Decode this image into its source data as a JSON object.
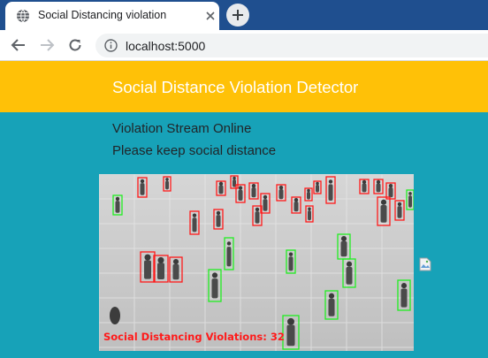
{
  "browser": {
    "tab_title": "Social Distancing violation",
    "url": "localhost:5000"
  },
  "header": {
    "title": "Social Distance Violation Detector"
  },
  "main": {
    "status": "Violation Stream Online",
    "notice": "Please keep social distance"
  },
  "video": {
    "overlay_text": "Social Distancing Violations: 32",
    "violation_count": 32
  },
  "colors": {
    "header_bg": "#ffc107",
    "page_bg": "#17a2b8",
    "violation_box": "#ff1a1a",
    "safe_box": "#22ee22"
  },
  "icons": [
    "globe-icon",
    "close-icon",
    "plus-icon",
    "back-arrow-icon",
    "forward-arrow-icon",
    "reload-icon",
    "info-icon",
    "broken-image-icon"
  ]
}
